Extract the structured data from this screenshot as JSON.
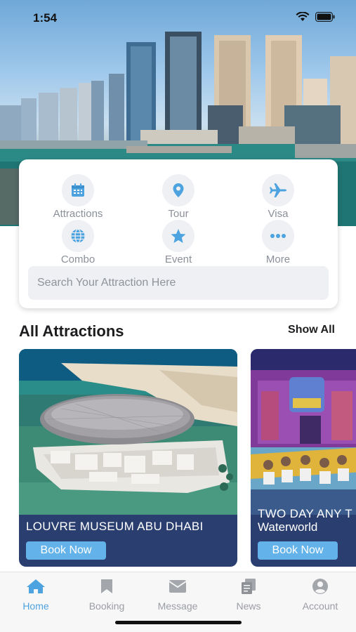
{
  "status_bar": {
    "time": "1:54"
  },
  "categories": [
    {
      "label": "Attractions",
      "icon": "calendar-icon"
    },
    {
      "label": "Tour",
      "icon": "location-pin-icon"
    },
    {
      "label": "Visa",
      "icon": "airplane-icon"
    },
    {
      "label": "Combo",
      "icon": "globe-icon"
    },
    {
      "label": "Event",
      "icon": "star-icon"
    },
    {
      "label": "More",
      "icon": "more-dots-icon"
    }
  ],
  "search": {
    "placeholder": "Search Your Attraction Here"
  },
  "section": {
    "title": "All Attractions",
    "show_all": "Show All"
  },
  "attractions": [
    {
      "name": "LOUVRE MUSEUM ABU DHABI",
      "book_label": "Book Now"
    },
    {
      "name_line1": "TWO DAY ANY T",
      "name_line2": "Waterworld",
      "book_label": "Book Now"
    }
  ],
  "tabs": [
    {
      "label": "Home",
      "icon": "home-icon",
      "active": true
    },
    {
      "label": "Booking",
      "icon": "bookmark-icon"
    },
    {
      "label": "Message",
      "icon": "envelope-icon"
    },
    {
      "label": "News",
      "icon": "documents-icon"
    },
    {
      "label": "Account",
      "icon": "user-circle-icon"
    }
  ],
  "colors": {
    "accent": "#4da3df",
    "card_dark": "#2a3f6f",
    "button": "#63b3ea"
  }
}
